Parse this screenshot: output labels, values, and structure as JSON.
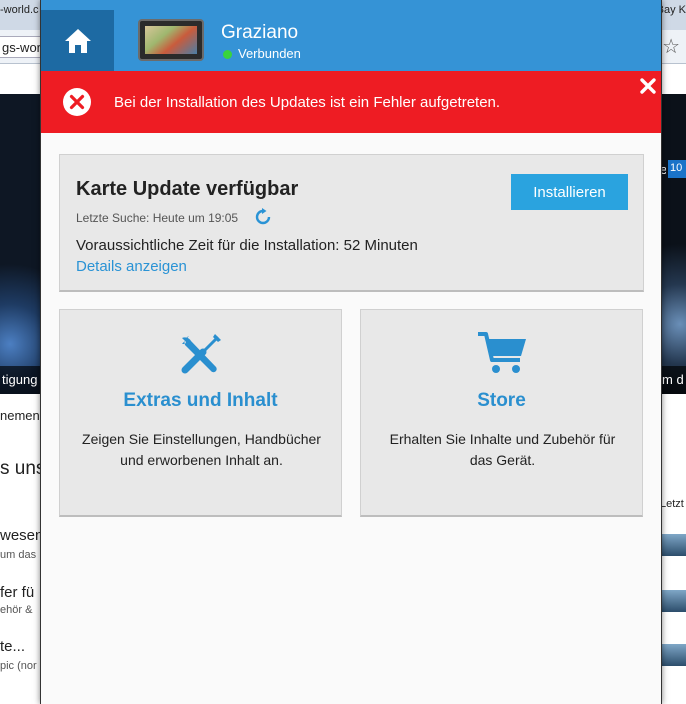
{
  "background": {
    "tab_left": "-world.c",
    "tab_right": "Bay K",
    "url_fragment": "gs-world",
    "caption_left": "tigung",
    "caption_right": "m d",
    "badge": "10",
    "list_left": [
      {
        "text": "nemen"
      },
      {
        "text": "s unse"
      },
      {
        "text": "wesen"
      },
      {
        "text": "um das"
      },
      {
        "text": "fer fü"
      },
      {
        "text": "ehör &"
      },
      {
        "text": "te..."
      },
      {
        "text": "pic (nor"
      }
    ],
    "list_right_label": "Letzt"
  },
  "header": {
    "device_name": "Graziano",
    "device_status": "Verbunden",
    "status_color": "#39d43c"
  },
  "error": {
    "message": "Bei der Installation des Updates ist ein Fehler aufgetreten.",
    "icon": "error-circle-x-icon",
    "color": "#ee1c23"
  },
  "update": {
    "title": "Karte Update verfügbar",
    "last_search": "Letzte Suche: Heute um 19:05",
    "install_time": "Voraussichtliche Zeit für die Installation: 52 Minuten",
    "details_link": "Details anzeigen",
    "install_button": "Installieren"
  },
  "tiles": {
    "extras": {
      "title": "Extras und Inhalt",
      "description": "Zeigen Sie Einstellungen, Handbücher und erworbenen Inhalt an.",
      "icon": "tools-icon"
    },
    "store": {
      "title": "Store",
      "description": "Erhalten Sie Inhalte und Zubehör für das Gerät.",
      "icon": "shopping-cart-icon"
    }
  },
  "colors": {
    "header_blue": "#3593d6",
    "home_blue": "#1d6aa3",
    "accent": "#2aa3df",
    "link": "#2a93d5"
  }
}
